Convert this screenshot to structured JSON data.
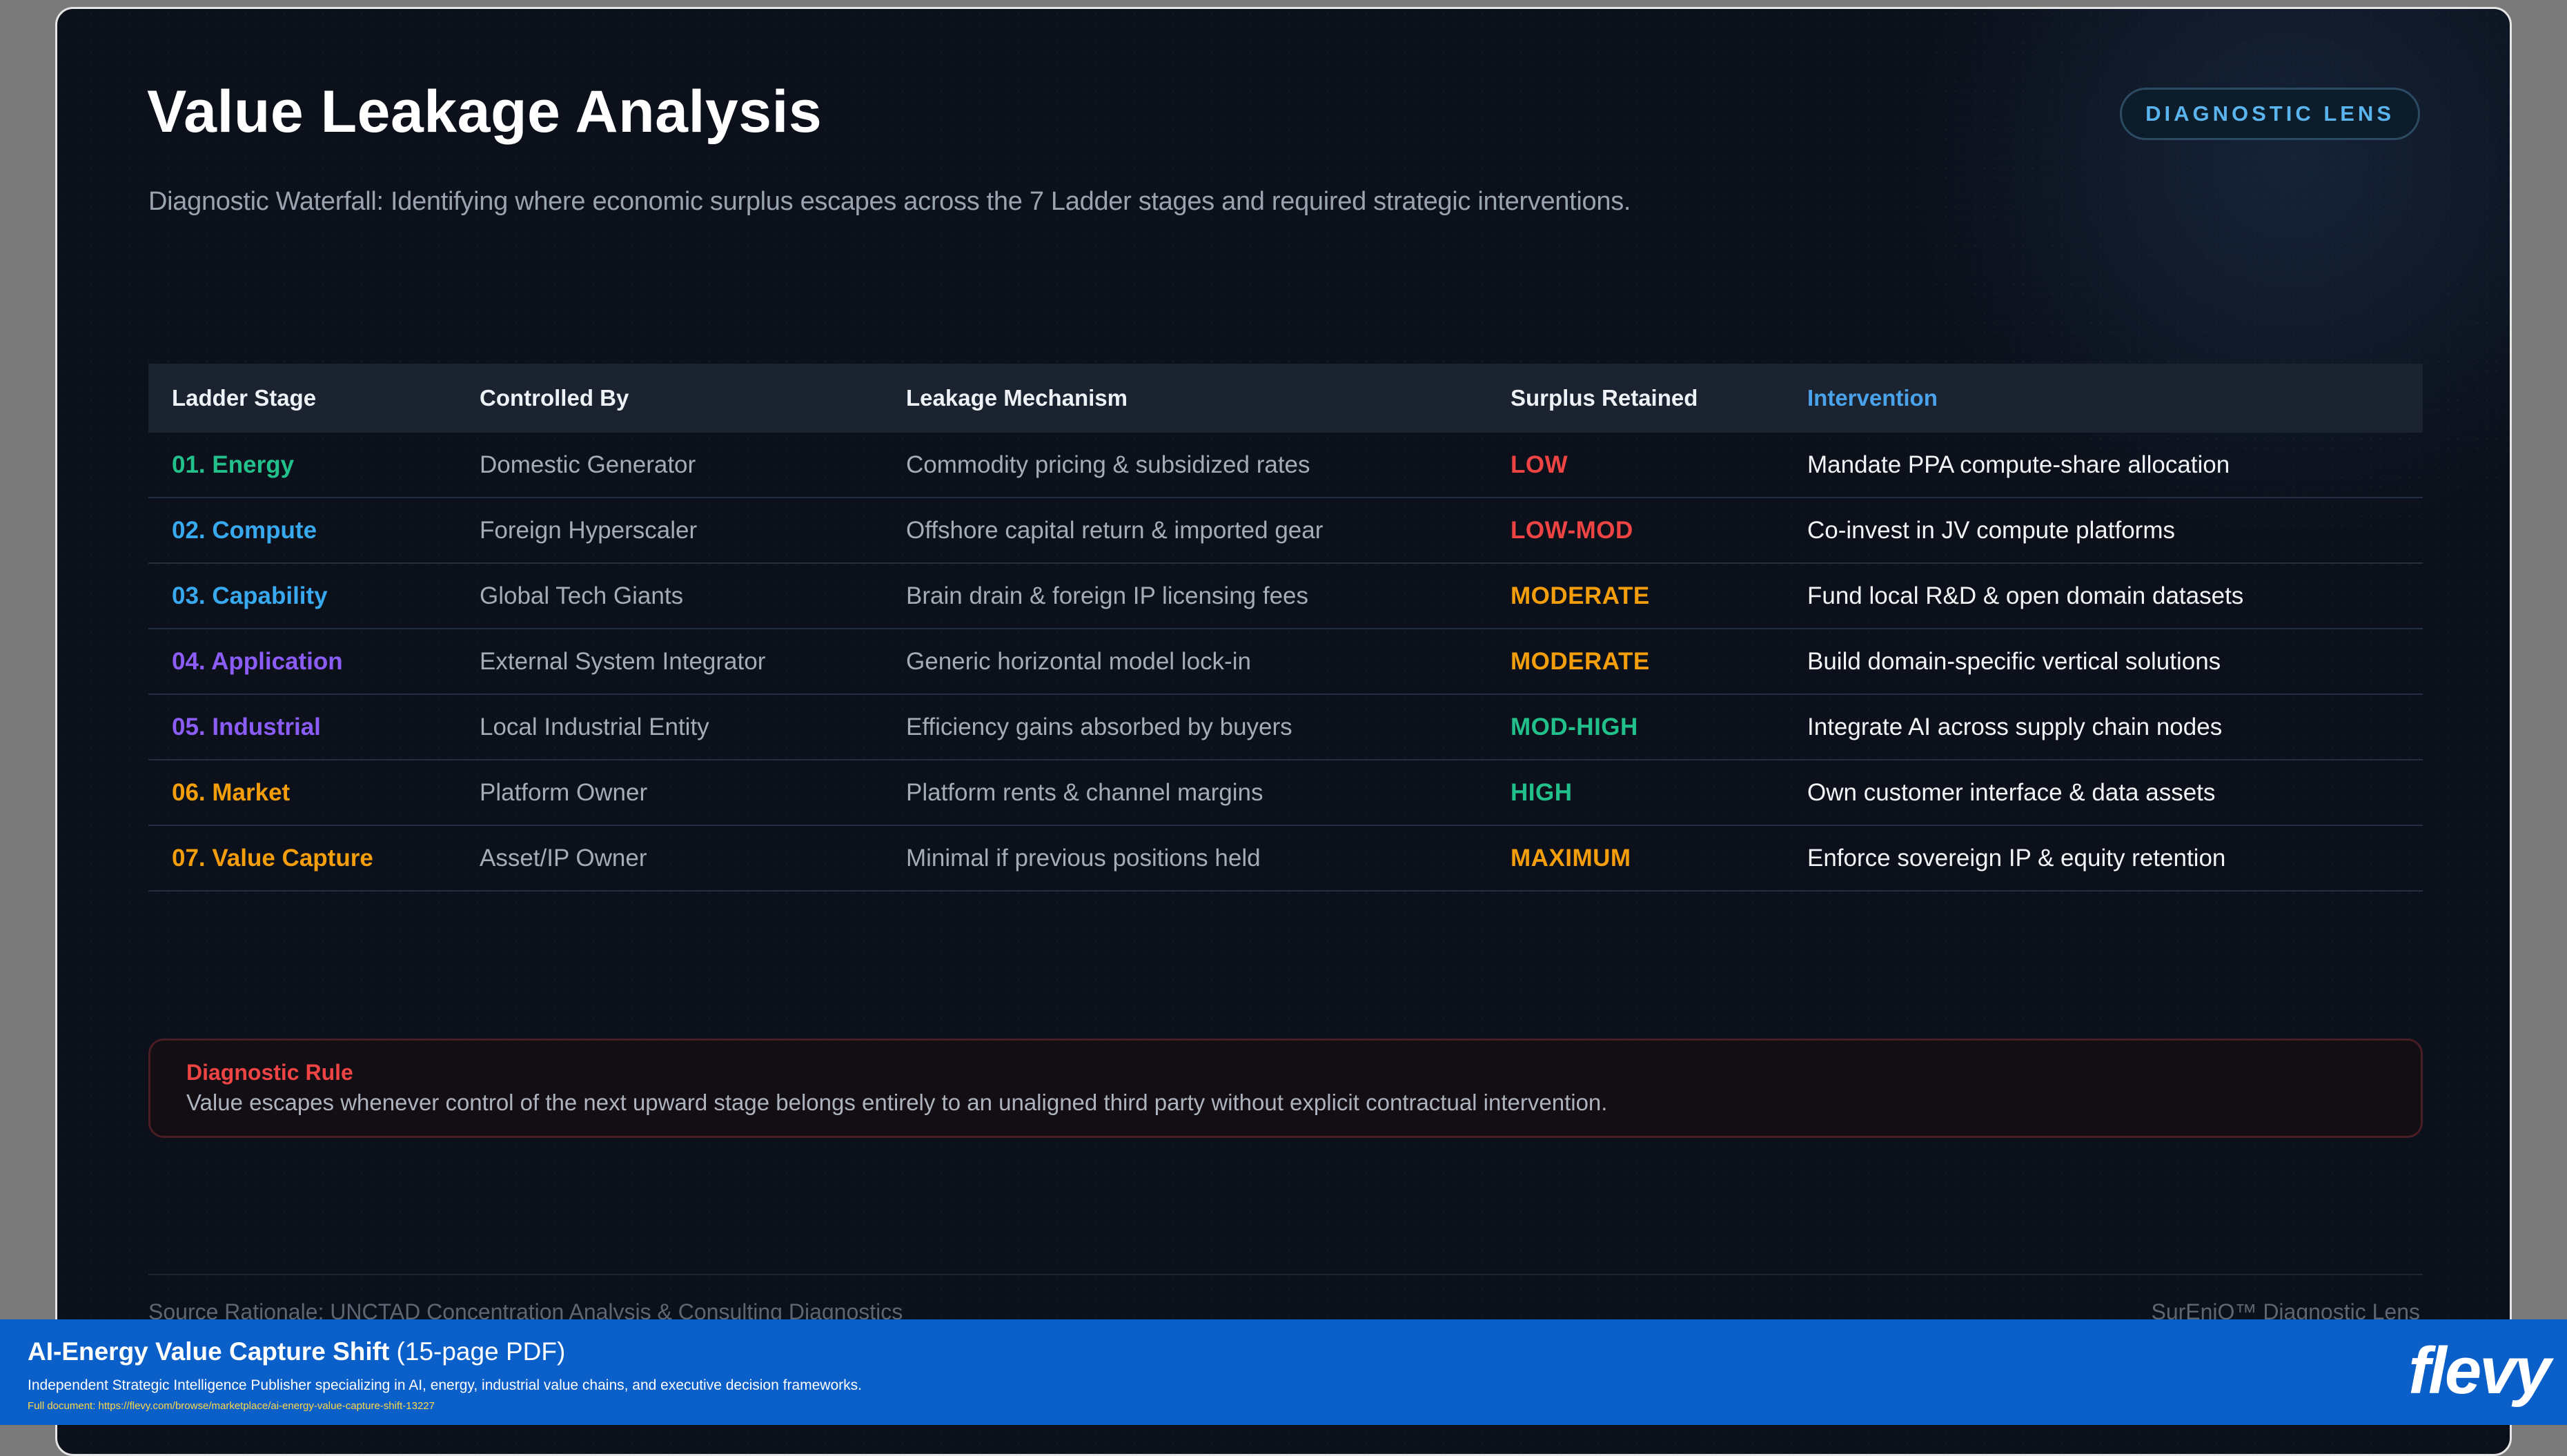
{
  "slide": {
    "title": "Value Leakage Analysis",
    "subtitle": "Diagnostic Waterfall: Identifying where economic surplus escapes across the 7 Ladder stages and required strategic interventions.",
    "badge": "DIAGNOSTIC LENS"
  },
  "table": {
    "headers": [
      "Ladder Stage",
      "Controlled By",
      "Leakage Mechanism",
      "Surplus Retained",
      "Intervention"
    ],
    "rows": [
      {
        "stage": "01. Energy",
        "controlled_by": "Domestic Generator",
        "mechanism": "Commodity pricing & subsidized rates",
        "surplus": "LOW",
        "intervention": "Mandate PPA compute-share allocation",
        "stage_color": "#22c08a",
        "surplus_color": "#ef4444"
      },
      {
        "stage": "02. Compute",
        "controlled_by": "Foreign Hyperscaler",
        "mechanism": "Offshore capital return & imported gear",
        "surplus": "LOW-MOD",
        "intervention": "Co-invest in JV compute platforms",
        "stage_color": "#38a9ee",
        "surplus_color": "#ef4444"
      },
      {
        "stage": "03. Capability",
        "controlled_by": "Global Tech Giants",
        "mechanism": "Brain drain & foreign IP licensing fees",
        "surplus": "MODERATE",
        "intervention": "Fund local R&D & open domain datasets",
        "stage_color": "#38a9ee",
        "surplus_color": "#f59e0b"
      },
      {
        "stage": "04. Application",
        "controlled_by": "External System Integrator",
        "mechanism": "Generic horizontal model lock-in",
        "surplus": "MODERATE",
        "intervention": "Build domain-specific vertical solutions",
        "stage_color": "#8b5cf6",
        "surplus_color": "#f59e0b"
      },
      {
        "stage": "05. Industrial",
        "controlled_by": "Local Industrial Entity",
        "mechanism": "Efficiency gains absorbed by buyers",
        "surplus": "MOD-HIGH",
        "intervention": "Integrate AI across supply chain nodes",
        "stage_color": "#8b5cf6",
        "surplus_color": "#22c08a"
      },
      {
        "stage": "06. Market",
        "controlled_by": "Platform Owner",
        "mechanism": "Platform rents & channel margins",
        "surplus": "HIGH",
        "intervention": "Own customer interface & data assets",
        "stage_color": "#f59e0b",
        "surplus_color": "#22c08a"
      },
      {
        "stage": "07. Value Capture",
        "controlled_by": "Asset/IP Owner",
        "mechanism": "Minimal if previous positions held",
        "surplus": "MAXIMUM",
        "intervention": "Enforce sovereign IP & equity retention",
        "stage_color": "#f59e0b",
        "surplus_color": "#f59e0b"
      }
    ]
  },
  "rule": {
    "title": "Diagnostic Rule",
    "text": "Value escapes whenever control of the next upward stage belongs entirely to an unaligned third party without explicit contractual intervention."
  },
  "footer": {
    "source": "Source Rationale: UNCTAD Concentration Analysis & Consulting Diagnostics",
    "brand_lens": "SurEniQ™ Diagnostic Lens"
  },
  "banner": {
    "title_bold": "AI-Energy Value Capture Shift",
    "title_suffix": " (15-page PDF)",
    "description": "Independent Strategic Intelligence Publisher specializing in AI, energy, industrial value chains, and executive decision frameworks.",
    "url": "Full document: https://flevy.com/browse/marketplace/ai-energy-value-capture-shift-13227",
    "logo": "flevy"
  }
}
